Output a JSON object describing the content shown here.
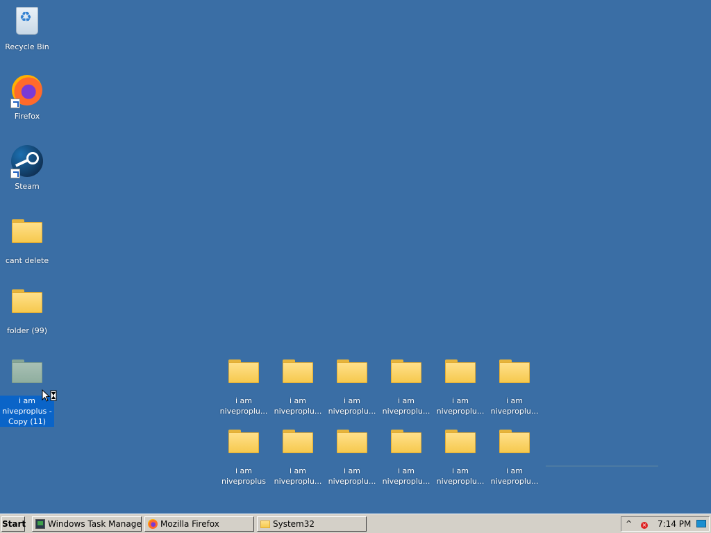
{
  "desktop": {
    "background_color": "#3a6ea5",
    "left_icons": [
      {
        "label": "Recycle Bin",
        "icon": "recycle-bin-icon"
      },
      {
        "label": "Firefox",
        "icon": "firefox-icon"
      },
      {
        "label": "Steam",
        "icon": "steam-icon"
      },
      {
        "label": "cant delete",
        "icon": "folder-icon"
      },
      {
        "label": "folder (99)",
        "icon": "folder-icon"
      },
      {
        "label": "i am niveproplus - Copy (11)",
        "icon": "folder-icon",
        "selected": true
      }
    ],
    "grid_row1": [
      {
        "label": "i am niveproplu..."
      },
      {
        "label": "i am niveproplu..."
      },
      {
        "label": "i am niveproplu..."
      },
      {
        "label": "i am niveproplu..."
      },
      {
        "label": "i am niveproplu..."
      },
      {
        "label": "i am niveproplu..."
      }
    ],
    "grid_row2": [
      {
        "label": "i am niveproplus"
      },
      {
        "label": "i am niveproplu..."
      },
      {
        "label": "i am niveproplu..."
      },
      {
        "label": "i am niveproplu..."
      },
      {
        "label": "i am niveproplu..."
      },
      {
        "label": "i am niveproplu..."
      }
    ]
  },
  "taskbar": {
    "start_label": "Start",
    "tasks": [
      {
        "label": "Windows Task Manager",
        "icon": "task-manager-icon"
      },
      {
        "label": "Mozilla Firefox",
        "icon": "firefox-icon"
      },
      {
        "label": "System32",
        "icon": "folder-icon"
      }
    ],
    "tray": {
      "clock": "7:14 PM",
      "chevron": "^",
      "error_glyph": "×"
    }
  }
}
